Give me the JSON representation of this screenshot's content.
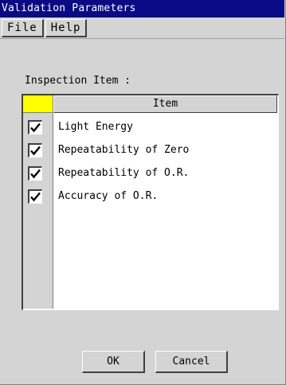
{
  "window": {
    "title": "Validation Parameters"
  },
  "menu": {
    "file_label": "File",
    "help_label": "Help"
  },
  "inspection": {
    "label": "Inspection Item :",
    "column_header": "Item",
    "items": [
      {
        "label": "Light Energy",
        "checked": true
      },
      {
        "label": "Repeatability of Zero",
        "checked": true
      },
      {
        "label": "Repeatability of O.R.",
        "checked": true
      },
      {
        "label": "Accuracy of O.R.",
        "checked": true
      }
    ]
  },
  "buttons": {
    "ok_label": "OK",
    "cancel_label": "Cancel"
  },
  "colors": {
    "titlebar": "#0a0a84",
    "header_corner": "#ffff00",
    "background": "#d4d4d4"
  }
}
